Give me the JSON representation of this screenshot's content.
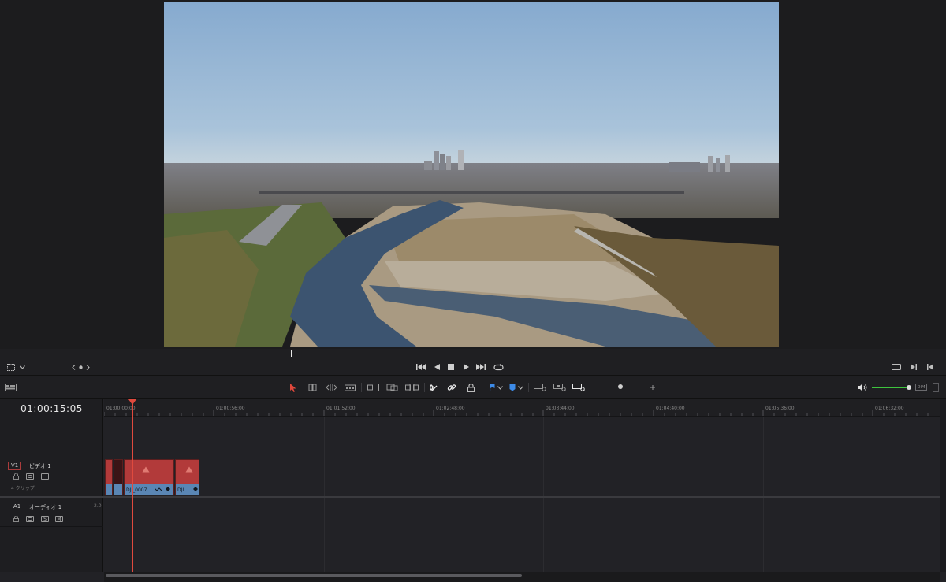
{
  "timeline": {
    "timecode": "01:00:15:05",
    "ruler_labels": [
      "01:00:00:00",
      "01:00:56:00",
      "01:01:52:00",
      "01:02:48:00",
      "01:03:44:00",
      "01:04:40:00",
      "01:05:36:00",
      "01:06:32:00"
    ]
  },
  "tracks": {
    "video": {
      "id": "V1",
      "name": "ビデオ 1",
      "clip_count": "4 クリップ"
    },
    "audio": {
      "id": "A1",
      "name": "オーディオ 1",
      "channels": "2.0",
      "solo": "S",
      "mute": "M"
    }
  },
  "clips": [
    {
      "name": ""
    },
    {
      "name": ""
    },
    {
      "name": "DJI_0007..."
    },
    {
      "name": "DJI..."
    }
  ],
  "toolbar": {
    "dim_label": "DIM"
  },
  "colors": {
    "clip": "#b23a3a",
    "clip_bar": "#5a86b4",
    "playhead": "#e04a3e",
    "volume": "#3ec43e"
  }
}
